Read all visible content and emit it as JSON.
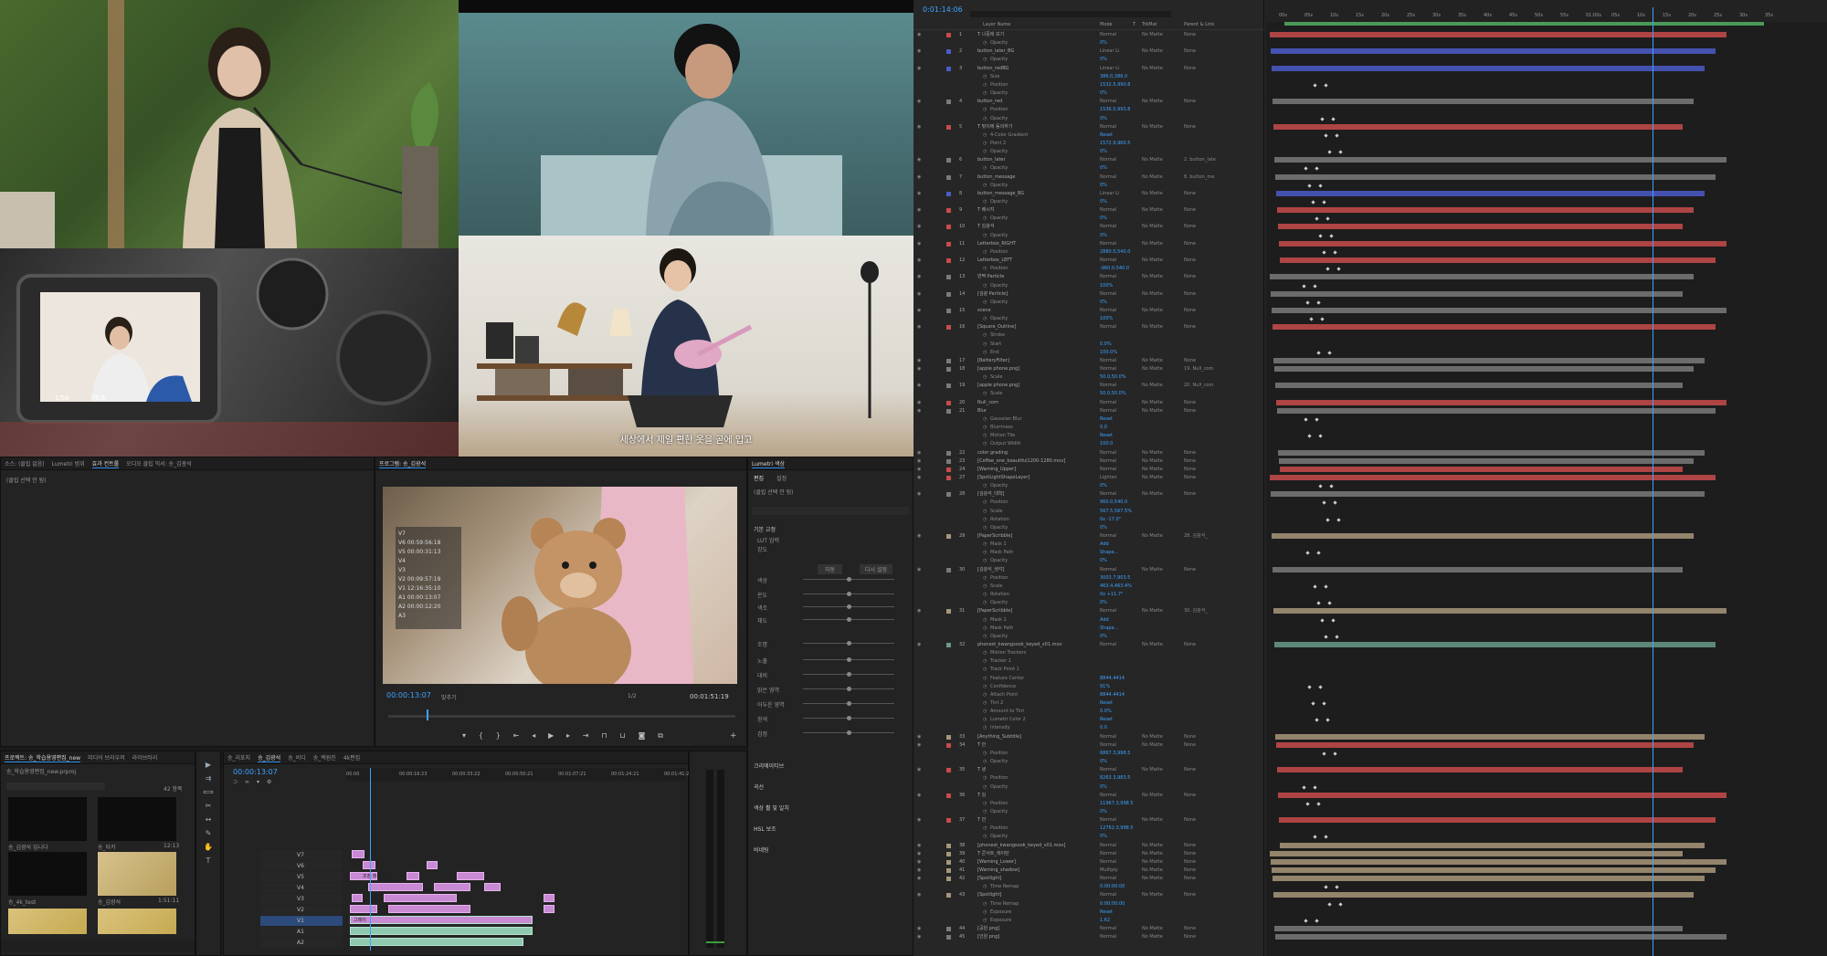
{
  "video_preview": {
    "subtitle": "세상에서 제일 편한 옷을 곧에 입고",
    "camera_screen": {
      "shutter": "1/50",
      "aperture": "F5.6"
    }
  },
  "premiere": {
    "source_panel": {
      "tabs": [
        "소스: (클립 없음)",
        "Lumetri 범위",
        "효과 컨트롤",
        "오디오 클립 믹서: 송_김광석"
      ],
      "active_tab": 2,
      "clip_label": "(클립 선택 안 됨)"
    },
    "program_monitor": {
      "title": "프로그램: 송_김광석",
      "overlay_lines": [
        "V7",
        "V6 00:59:56:18",
        "V5 00:00:31:13",
        "V4",
        "V3",
        "V2 00:09:57:19",
        "V1 12:16:35:10",
        "A1 00:00:13:07",
        "A2 00:00:12:20",
        "A3"
      ],
      "timecode": "00:00:13:07",
      "fit": "맞추기",
      "quality": "1/2",
      "duration": "00:01:51:19"
    },
    "lumetri": {
      "title": "Lumetri 색상",
      "tabs": [
        "편집",
        "설정"
      ],
      "clip_label": "(클립 선택 안 됨)",
      "sections": [
        "기본 교정",
        "크리에이티브",
        "곡선",
        "색상 휠 및 일치",
        "HSL 보조",
        "비네팅"
      ],
      "basic_labels": [
        "LUT 입력",
        "강도",
        "색상",
        "온도",
        "색조",
        "채도",
        "조명",
        "노출",
        "대비",
        "밝은 영역",
        "어두운 영역",
        "흰색",
        "검정"
      ],
      "auto_btn": "자동",
      "reset_btn": "다시 설정"
    },
    "project": {
      "tabs": [
        "프로젝트: 송_학습용영편집_new",
        "미디어 브라우저",
        "라이브러리"
      ],
      "file": "송_학습용영편집_new.prproj",
      "count": "42 항목",
      "items": [
        {
          "name": "송_김광석 입니다",
          "dur": ""
        },
        {
          "name": "송_타카",
          "dur": "12:13"
        },
        {
          "name": "송_4k_test",
          "dur": ""
        },
        {
          "name": "송_김광석",
          "dur": "1:51:11"
        }
      ]
    },
    "timeline": {
      "tabs": [
        "송_리포지",
        "송_김광석",
        "송_비디",
        "송_백원진",
        "4k편집"
      ],
      "active_tab": 1,
      "timecode": "00:00:13:07",
      "ruler": [
        "00:00",
        "00:00:16:23",
        "00:00:33:22",
        "00:00:50:21",
        "00:01:07:21",
        "00:01:24:21",
        "00:01:41:20"
      ],
      "tracks": [
        "V7",
        "V6",
        "V5",
        "V4",
        "V3",
        "V2",
        "V1",
        "A1",
        "A2"
      ],
      "clip_label1": "조청 레이어",
      "clip_label2": "그레이"
    }
  },
  "after_effects": {
    "timecode": "0:01:14:06",
    "columns": [
      "Layer Name",
      "Mode",
      "T",
      "TrkMat",
      "Parent & Link"
    ],
    "ruler": [
      "00s",
      "05s",
      "10s",
      "15s",
      "20s",
      "25s",
      "30s",
      "35s",
      "40s",
      "45s",
      "50s",
      "55s",
      "01:00s",
      "05s",
      "10s",
      "15s",
      "20s",
      "25s",
      "30s",
      "35s"
    ],
    "layers": [
      {
        "n": "1",
        "name": "T  나중에 보기",
        "mode": "Normal",
        "trk": "No Matte",
        "parent": "None",
        "color": "#c84b4b"
      },
      {
        "p": "Opacity",
        "v": "0%"
      },
      {
        "n": "2",
        "name": "button_later_BG",
        "mode": "Linear Li",
        "trk": "No Matte",
        "parent": "None",
        "color": "#4b5bc8"
      },
      {
        "p": "Opacity",
        "v": "0%"
      },
      {
        "n": "3",
        "name": "button_redBG",
        "mode": "Linear Li",
        "trk": "No Matte",
        "parent": "None",
        "color": "#4b5bc8"
      },
      {
        "p": "Size",
        "v": "386.0,386.0"
      },
      {
        "p": "Position",
        "v": "1532.5,990.8"
      },
      {
        "p": "Opacity",
        "v": "0%"
      },
      {
        "n": "4",
        "name": "button_red",
        "mode": "Normal",
        "trk": "No Matte",
        "parent": "None",
        "color": "#7a7a7a"
      },
      {
        "p": "Position",
        "v": "1536.5,993.8"
      },
      {
        "p": "Opacity",
        "v": "0%"
      },
      {
        "n": "5",
        "name": "T  맞이에 동의하기",
        "mode": "Normal",
        "trk": "No Matte",
        "parent": "None",
        "color": "#c84b4b"
      },
      {
        "p": "4-Color Gradient",
        "v": "Reset"
      },
      {
        "p": "Point 2",
        "v": "1572.9,960.5"
      },
      {
        "p": "Opacity",
        "v": "0%"
      },
      {
        "n": "6",
        "name": "button_later",
        "mode": "Normal",
        "trk": "No Matte",
        "parent": "2. button_late",
        "color": "#7a7a7a"
      },
      {
        "p": "Opacity",
        "v": "0%"
      },
      {
        "n": "7",
        "name": "button_message",
        "mode": "Normal",
        "trk": "No Matte",
        "parent": "8. button_me",
        "color": "#7a7a7a"
      },
      {
        "p": "Opacity",
        "v": "0%"
      },
      {
        "n": "8",
        "name": "button_message_BG",
        "mode": "Linear Li",
        "trk": "No Matte",
        "parent": "None",
        "color": "#4b5bc8"
      },
      {
        "p": "Opacity",
        "v": "0%"
      },
      {
        "n": "9",
        "name": "T  배시지",
        "mode": "Normal",
        "trk": "No Matte",
        "parent": "None",
        "color": "#c84b4b"
      },
      {
        "p": "Opacity",
        "v": "0%"
      },
      {
        "n": "10",
        "name": "T  김광석",
        "mode": "Normal",
        "trk": "No Matte",
        "parent": "None",
        "color": "#c84b4b"
      },
      {
        "p": "Opacity",
        "v": "0%"
      },
      {
        "n": "11",
        "name": "Letterbox_RIGHT",
        "mode": "Normal",
        "trk": "No Matte",
        "parent": "None",
        "color": "#c84b4b"
      },
      {
        "p": "Position",
        "v": "2880.0,540.0"
      },
      {
        "n": "12",
        "name": "Letterbox_LEFT",
        "mode": "Normal",
        "trk": "No Matte",
        "parent": "None",
        "color": "#c84b4b"
      },
      {
        "p": "Position",
        "v": "-960.0,540.0"
      },
      {
        "n": "13",
        "name": "반짝 Particle",
        "mode": "Normal",
        "trk": "No Matte",
        "parent": "None",
        "color": "#7a7a7a"
      },
      {
        "p": "Opacity",
        "v": "100%"
      },
      {
        "n": "14",
        "name": "[김광 Particle]",
        "mode": "Normal",
        "trk": "No Matte",
        "parent": "None",
        "color": "#7a7a7a"
      },
      {
        "p": "Opacity",
        "v": "0%"
      },
      {
        "n": "15",
        "name": "scene",
        "mode": "Normal",
        "trk": "No Matte",
        "parent": "None",
        "color": "#7a7a7a"
      },
      {
        "p": "Opacity",
        "v": "100%"
      },
      {
        "n": "16",
        "name": "[Square_Outline]",
        "mode": "Normal",
        "trk": "No Matte",
        "parent": "None",
        "color": "#c84b4b"
      },
      {
        "p": "Stroke",
        "v": ""
      },
      {
        "p": "Start",
        "v": "0.0%"
      },
      {
        "p": "End",
        "v": "100.0%"
      },
      {
        "n": "17",
        "name": "[BatteryFilter]",
        "mode": "Normal",
        "trk": "No Matte",
        "parent": "None",
        "color": "#7a7a7a"
      },
      {
        "n": "18",
        "name": "[apple phone.png]",
        "mode": "Normal",
        "trk": "No Matte",
        "parent": "19. Null_com",
        "color": "#7a7a7a"
      },
      {
        "p": "Scale",
        "v": "50.0,50.0%"
      },
      {
        "n": "19",
        "name": "[apple phone.png]",
        "mode": "Normal",
        "trk": "No Matte",
        "parent": "20. Null_com",
        "color": "#7a7a7a"
      },
      {
        "p": "Scale",
        "v": "50.0,50.0%"
      },
      {
        "n": "20",
        "name": "Null_com",
        "mode": "Normal",
        "trk": "No Matte",
        "parent": "None",
        "color": "#c84b4b"
      },
      {
        "n": "21",
        "name": "Blur",
        "mode": "Normal",
        "trk": "No Matte",
        "parent": "None",
        "color": "#7a7a7a"
      },
      {
        "p": "Gaussian Blur",
        "v": "Reset"
      },
      {
        "p": "Blurriness",
        "v": "0.0"
      },
      {
        "p": "Motion Tile",
        "v": "Reset"
      },
      {
        "p": "Output Width",
        "v": "100.0"
      },
      {
        "n": "22",
        "name": "color grading",
        "mode": "Normal",
        "trk": "No Matte",
        "parent": "None",
        "color": "#7a7a7a"
      },
      {
        "n": "23",
        "name": "[Coffee_one_beautiful1200-1280.mov]",
        "mode": "Normal",
        "trk": "No Matte",
        "parent": "None",
        "color": "#7a7a7a"
      },
      {
        "n": "24",
        "name": "[Warning_Upper]",
        "mode": "Normal",
        "trk": "No Matte",
        "parent": "None",
        "color": "#c84b4b"
      },
      {
        "n": "27",
        "name": "[SpotLightShapeLayer]",
        "mode": "Lighten",
        "trk": "No Matte",
        "parent": "None",
        "color": "#c84b4b"
      },
      {
        "p": "Opacity",
        "v": "0%"
      },
      {
        "n": "28",
        "name": "[김광석_대학]",
        "mode": "Normal",
        "trk": "No Matte",
        "parent": "None",
        "color": "#7a7a7a"
      },
      {
        "p": "Position",
        "v": "960.0,540.0"
      },
      {
        "p": "Scale",
        "v": "567.5,567.5%"
      },
      {
        "p": "Rotation",
        "v": "0x -17.0°"
      },
      {
        "p": "Opacity",
        "v": "0%"
      },
      {
        "n": "29",
        "name": "[PaperScribble]",
        "mode": "Normal",
        "trk": "No Matte",
        "parent": "28. 김광석_",
        "color": "#a8967a"
      },
      {
        "p": "Mask 1",
        "v": "Add"
      },
      {
        "p": "Mask Path",
        "v": "Shape..."
      },
      {
        "p": "Opacity",
        "v": "0%"
      },
      {
        "n": "30",
        "name": "[김광석_생각]",
        "mode": "Normal",
        "trk": "No Matte",
        "parent": "None",
        "color": "#7a7a7a"
      },
      {
        "p": "Position",
        "v": "3003.7,903.5"
      },
      {
        "p": "Scale",
        "v": "463.4,463.4%"
      },
      {
        "p": "Rotation",
        "v": "0x +11.7°"
      },
      {
        "p": "Opacity",
        "v": "0%"
      },
      {
        "n": "31",
        "name": "[PaperScribble]",
        "mode": "Normal",
        "trk": "No Matte",
        "parent": "30. 김광석_",
        "color": "#a8967a"
      },
      {
        "p": "Mask 1",
        "v": "Add"
      },
      {
        "p": "Mask Path",
        "v": "Shape..."
      },
      {
        "p": "Opacity",
        "v": "0%"
      },
      {
        "n": "32",
        "name": "phonest_kwangsook_keyed_v01.mov",
        "mode": "Normal",
        "trk": "No Matte",
        "parent": "None",
        "color": "#6a9a8a"
      },
      {
        "p": "Motion Trackers",
        "v": ""
      },
      {
        "p": "Tracker 1",
        "v": ""
      },
      {
        "p": "Track Point 1",
        "v": ""
      },
      {
        "p": "Feature Center",
        "v": "8844.4414"
      },
      {
        "p": "Confidence",
        "v": "91%"
      },
      {
        "p": "Attach Point",
        "v": "8844.4414"
      },
      {
        "p": "Tint 2",
        "v": "Reset"
      },
      {
        "p": "Amount to Tint",
        "v": "0.0%"
      },
      {
        "p": "Lumetri Color 2",
        "v": "Reset"
      },
      {
        "p": "Intensity",
        "v": "0.0"
      },
      {
        "n": "33",
        "name": "[Anything_Subtitle]",
        "mode": "Normal",
        "trk": "No Matte",
        "parent": "None",
        "color": "#a8967a"
      },
      {
        "n": "34",
        "name": "T  안",
        "mode": "Normal",
        "trk": "No Matte",
        "parent": "None",
        "color": "#c84b4b"
      },
      {
        "p": "Position",
        "v": "6867.3,998.5"
      },
      {
        "p": "Opacity",
        "v": "0%"
      },
      {
        "n": "35",
        "name": "T  녕",
        "mode": "Normal",
        "trk": "No Matte",
        "parent": "None",
        "color": "#c84b4b"
      },
      {
        "p": "Position",
        "v": "8263.3,983.5"
      },
      {
        "p": "Opacity",
        "v": "0%"
      },
      {
        "n": "36",
        "name": "T  김",
        "mode": "Normal",
        "trk": "No Matte",
        "parent": "None",
        "color": "#c84b4b"
      },
      {
        "p": "Position",
        "v": "11967.3,998.5"
      },
      {
        "p": "Opacity",
        "v": "0%"
      },
      {
        "n": "37",
        "name": "T  안",
        "mode": "Normal",
        "trk": "No Matte",
        "parent": "None",
        "color": "#c84b4b"
      },
      {
        "p": "Position",
        "v": "12762.3,998.5"
      },
      {
        "p": "Opacity",
        "v": "0%"
      },
      {
        "n": "38",
        "name": "[phonest_kwangsook_keyed_v01.mov]",
        "mode": "Normal",
        "trk": "No Matte",
        "parent": "None",
        "color": "#a8967a"
      },
      {
        "n": "39",
        "name": "T  콘서트_레이탄",
        "mode": "Normal",
        "trk": "No Matte",
        "parent": "None",
        "color": "#a8967a"
      },
      {
        "n": "40",
        "name": "[Warning_Lower]",
        "mode": "Normal",
        "trk": "No Matte",
        "parent": "None",
        "color": "#a8967a"
      },
      {
        "n": "41",
        "name": "[Warning_shadow]",
        "mode": "Multiply",
        "trk": "No Matte",
        "parent": "None",
        "color": "#a8967a"
      },
      {
        "n": "42",
        "name": "[Spotlight]",
        "mode": "Normal",
        "trk": "No Matte",
        "parent": "None",
        "color": "#a8967a"
      },
      {
        "p": "Time Remap",
        "v": "0:00:00:00"
      },
      {
        "n": "43",
        "name": "[Spotlight]",
        "mode": "Normal",
        "trk": "No Matte",
        "parent": "None",
        "color": "#a8967a"
      },
      {
        "p": "Time Remap",
        "v": "0:00:00:00"
      },
      {
        "p": "Exposure",
        "v": "Reset"
      },
      {
        "p": "Exposure",
        "v": "1.62"
      },
      {
        "n": "44",
        "name": "[공원 png]",
        "mode": "Normal",
        "trk": "No Matte",
        "parent": "None",
        "color": "#7a7a7a"
      },
      {
        "n": "45",
        "name": "[인원 png]",
        "mode": "Normal",
        "trk": "No Matte",
        "parent": "None",
        "color": "#7a7a7a"
      }
    ]
  }
}
